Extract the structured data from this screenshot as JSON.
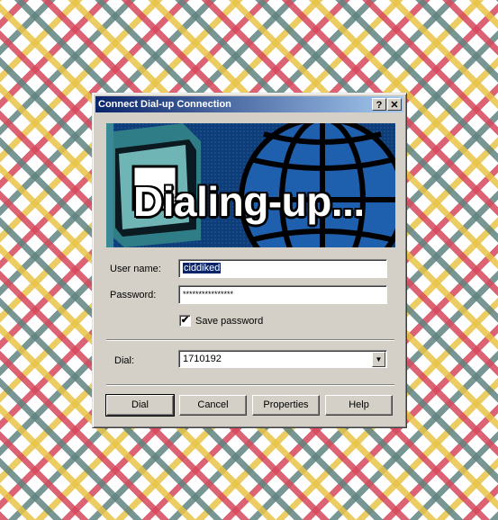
{
  "dialog": {
    "title": "Connect Dial-up Connection",
    "help_button": "?",
    "close_button": "✕"
  },
  "banner": {
    "text": "Dialing-up..."
  },
  "form": {
    "username_label": "User name:",
    "username_value": "ciddiked",
    "password_label": "Password:",
    "password_value": "****************",
    "save_password_label": "Save password",
    "save_password_checked": true,
    "save_password_mark": "✔",
    "dial_label": "Dial:",
    "dial_value": "1710192",
    "dropdown_arrow": "▼"
  },
  "buttons": {
    "dial": "Dial",
    "cancel": "Cancel",
    "properties": "Properties",
    "help": "Help"
  },
  "colors": {
    "titlebar_start": "#0a246a",
    "titlebar_end": "#a6caf0",
    "dialog_face": "#d4d0c8",
    "banner_bg": "#0f3d78"
  }
}
